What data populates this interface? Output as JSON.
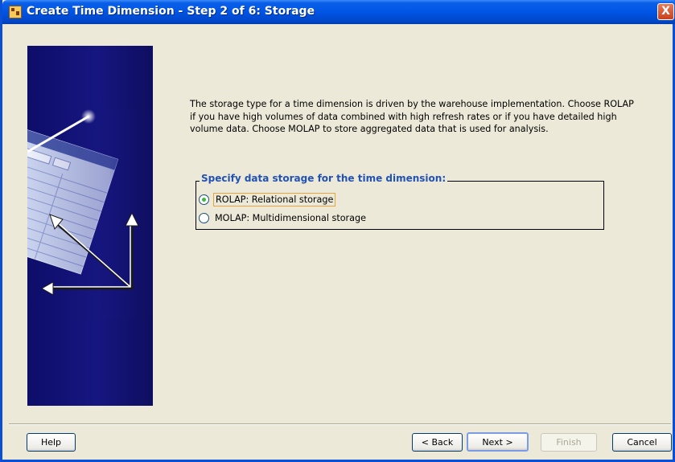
{
  "window": {
    "title": "Create Time Dimension - Step 2 of 6: Storage",
    "close_label": "X"
  },
  "description": "The storage type for a time dimension is driven by the warehouse implementation. Choose ROLAP if you have high volumes of data combined with high refresh rates or if you have detailed high volume data. Choose MOLAP to store aggregated data that is used for analysis.",
  "storage_group": {
    "legend": "Specify data storage for the time dimension:",
    "options": [
      {
        "label": "ROLAP: Relational storage",
        "checked": true
      },
      {
        "label": "MOLAP: Multidimensional storage",
        "checked": false
      }
    ]
  },
  "buttons": {
    "help": "Help",
    "back": "< Back",
    "next": "Next >",
    "finish": "Finish",
    "cancel": "Cancel"
  },
  "colors": {
    "titlebar": "#0055e5",
    "legend_text": "#2152b4",
    "side_panel": "#161680",
    "radio_checked": "#3fb83f"
  },
  "icons": [
    "app-icon",
    "close-icon",
    "wizard-illustration"
  ]
}
